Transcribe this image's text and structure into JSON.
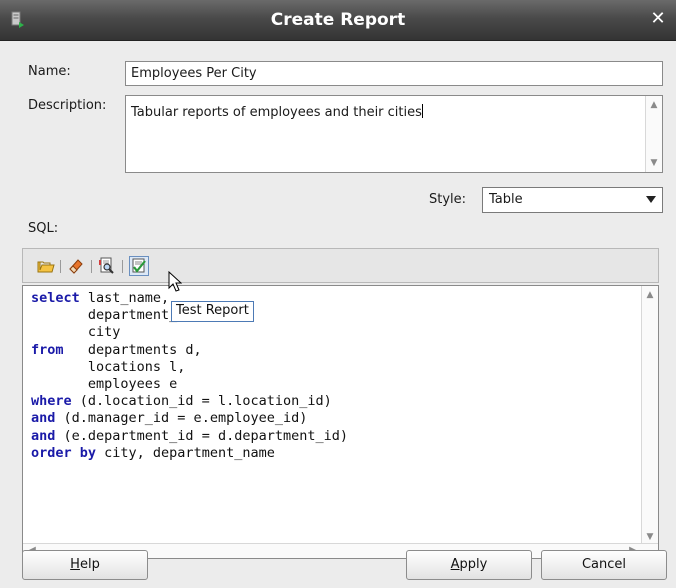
{
  "window": {
    "title": "Create Report"
  },
  "form": {
    "name_label": "Name:",
    "name_value": "Employees Per City",
    "description_label": "Description:",
    "description_value": "Tabular reports of employees and their cities",
    "style_label": "Style:",
    "style_value": "Table",
    "sql_label": "SQL:"
  },
  "toolbar": {
    "buttons": [
      {
        "icon": "folder-open-icon"
      },
      {
        "icon": "eraser-icon"
      },
      {
        "icon": "query-builder-icon"
      },
      {
        "icon": "test-report-icon"
      }
    ],
    "tooltip": "Test Report"
  },
  "sql": {
    "lines": [
      {
        "kw": "select",
        "text": " last_name,"
      },
      {
        "kw": "",
        "text": "       department_name,"
      },
      {
        "kw": "",
        "text": "       city"
      },
      {
        "kw": "from",
        "text": "   departments d,"
      },
      {
        "kw": "",
        "text": "       locations l,"
      },
      {
        "kw": "",
        "text": "       employees e"
      },
      {
        "kw": "where",
        "text": " (d.location_id = l.location_id)"
      },
      {
        "kw": "and",
        "text": " (d.manager_id = e.employee_id)"
      },
      {
        "kw": "and",
        "text": " (e.department_id = d.department_id)"
      },
      {
        "kw": "order by",
        "text": " city, department_name"
      }
    ]
  },
  "buttons": {
    "help_mnemonic": "H",
    "help_rest": "elp",
    "apply_mnemonic": "A",
    "apply_rest": "pply",
    "cancel": "Cancel"
  },
  "colors": {
    "keyword": "#1a1aa8",
    "tooltip_border": "#4d7ab5",
    "titlebar": "#4a4a4a"
  }
}
